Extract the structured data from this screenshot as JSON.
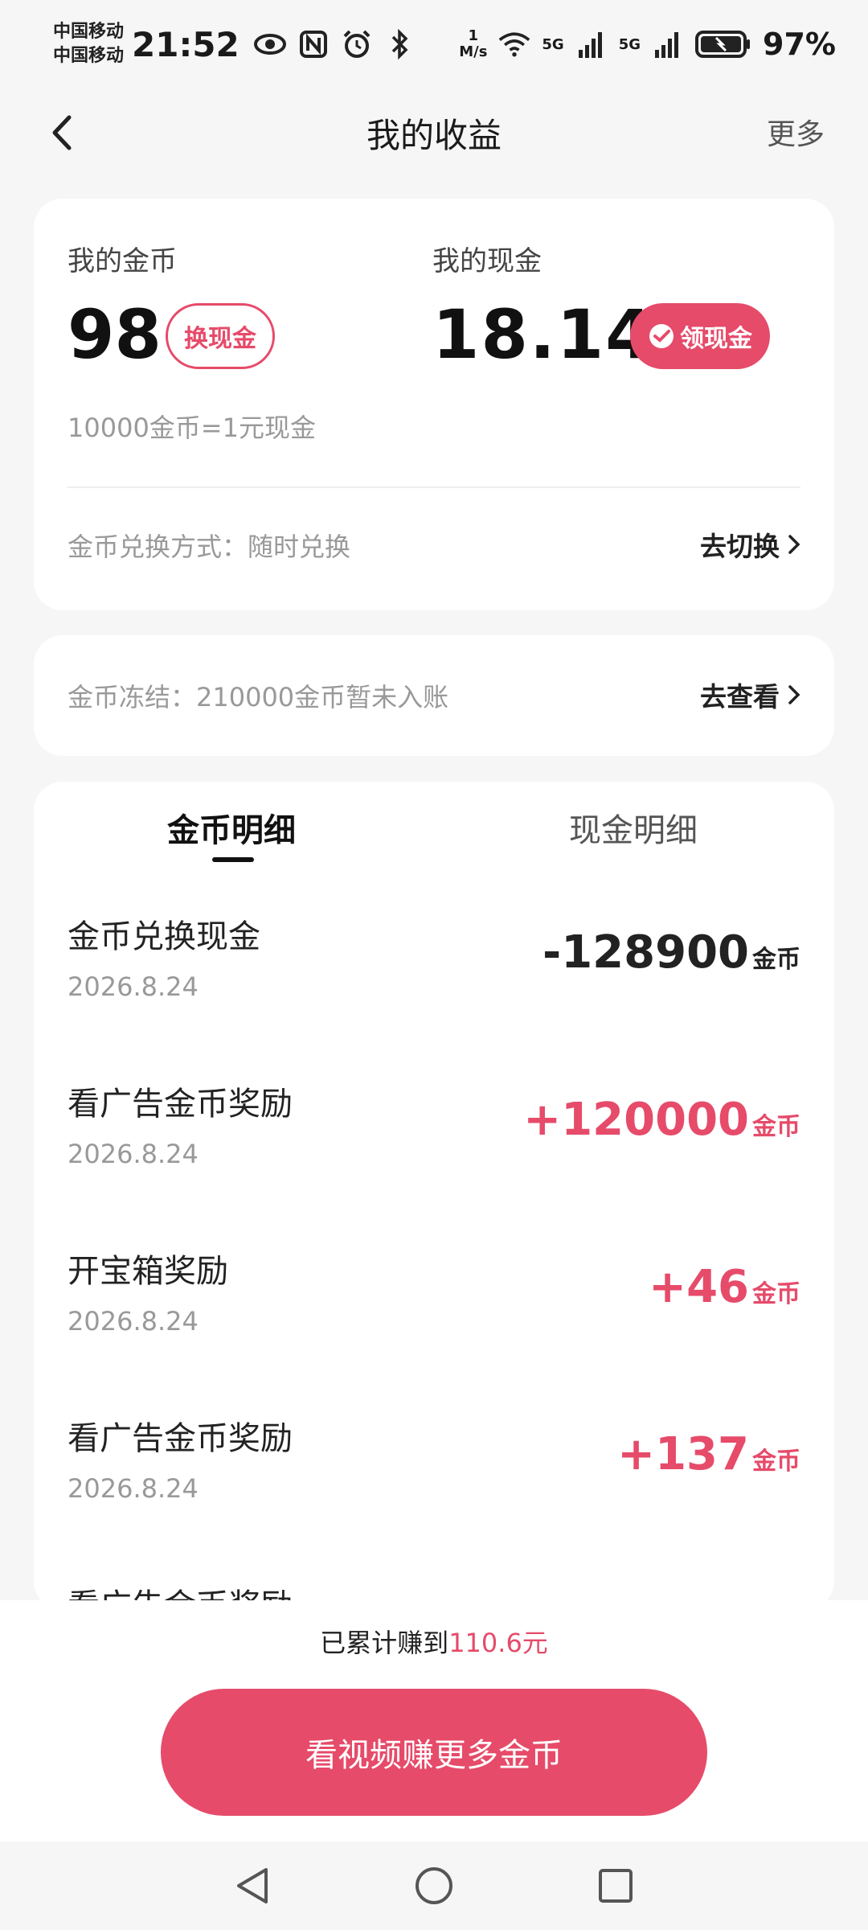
{
  "status_bar": {
    "carrier1": "中国移动",
    "carrier2": "中国移动",
    "time": "21:52",
    "speed_value": "1",
    "speed_unit": "M/s",
    "net1": "5G",
    "net2": "5G",
    "battery": "97%",
    "icons": [
      "eye-icon",
      "nfc-icon",
      "alarm-icon",
      "bluetooth-icon",
      "wifi-icon",
      "signal-icon",
      "battery-icon"
    ]
  },
  "header": {
    "title": "我的收益",
    "more": "更多"
  },
  "summary": {
    "coins_label": "我的金币",
    "coins_value": "98",
    "exchange_button": "换现金",
    "cash_label": "我的现金",
    "cash_value": "18.14",
    "withdraw_button": "领现金",
    "rate_text": "10000金币=1元现金",
    "exchange_method": "金币兑换方式：随时兑换",
    "switch_link": "去切换"
  },
  "frozen": {
    "text": "金币冻结：210000金币暂未入账",
    "link": "去查看"
  },
  "details": {
    "tabs": [
      "金币明细",
      "现金明细"
    ],
    "transactions": [
      {
        "title": "金币兑换现金",
        "date": "2026.8.24",
        "amount": "-128900",
        "unit": "金币"
      },
      {
        "title": "看广告金币奖励",
        "date": "2026.8.24",
        "amount": "+120000",
        "unit": "金币"
      },
      {
        "title": "开宝箱奖励",
        "date": "2026.8.24",
        "amount": "+46",
        "unit": "金币"
      },
      {
        "title": "看广告金币奖励",
        "date": "2026.8.24",
        "amount": "+137",
        "unit": "金币"
      },
      {
        "title": "看广告金币奖励",
        "date": "",
        "amount": "",
        "unit": ""
      }
    ]
  },
  "footer": {
    "earned_prefix": "已累计赚到",
    "earned_amount": "110.6元",
    "cta": "看视频赚更多金币"
  },
  "colors": {
    "accent": "#e64b6a",
    "background": "#f6f6f6"
  }
}
